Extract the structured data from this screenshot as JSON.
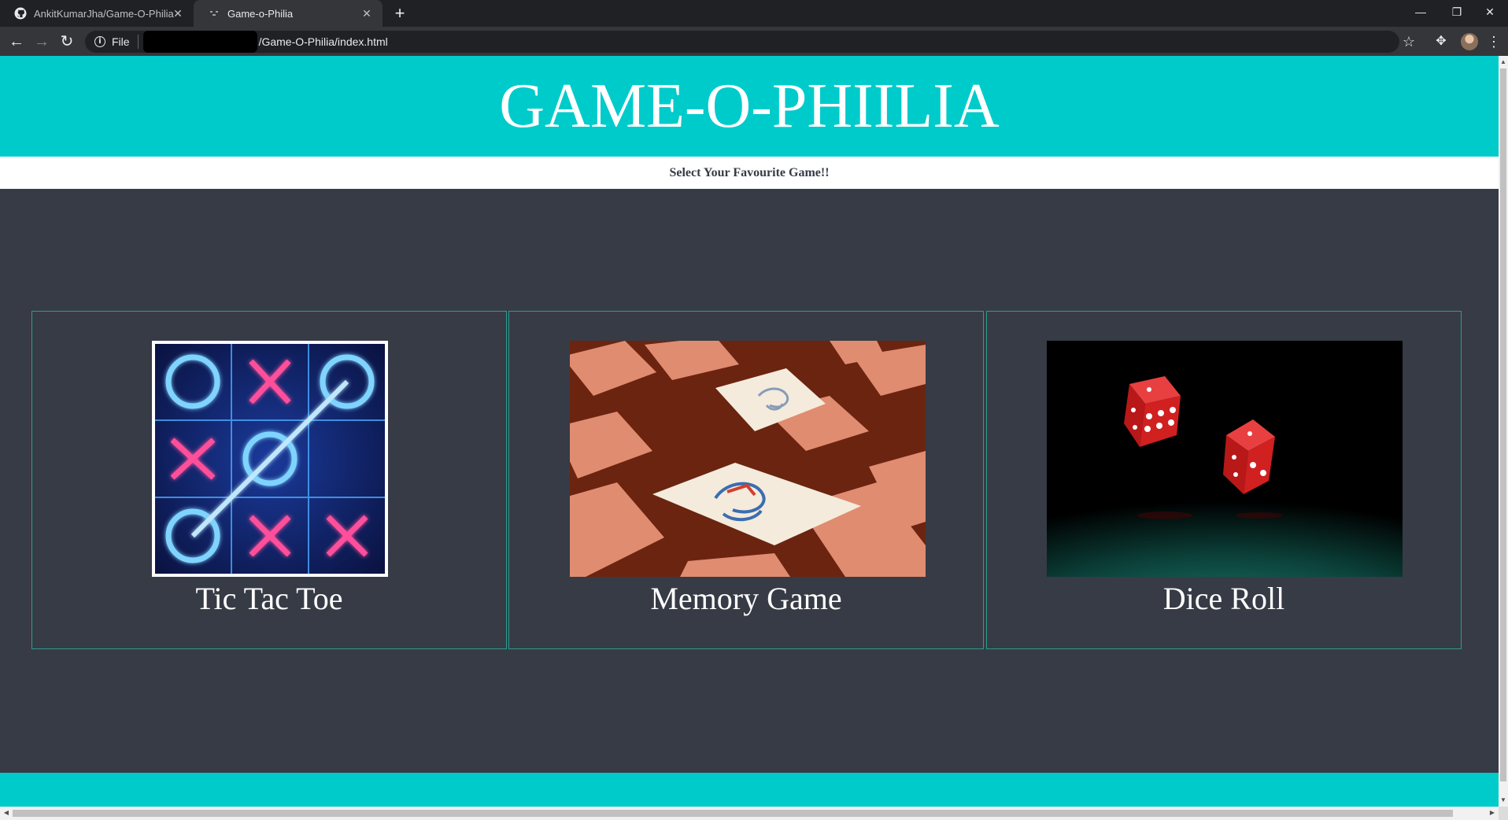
{
  "browser": {
    "tabs": [
      {
        "title": "AnkitKumarJha/Game-O-Philia",
        "icon": "github-icon"
      },
      {
        "title": "Game-o-Philia",
        "icon": "page-icon"
      }
    ],
    "address": {
      "scheme_label": "File",
      "path": "/Game-O-Philia/index.html"
    }
  },
  "page": {
    "title": "GAME-O-PHIILIA",
    "subtitle": "Select Your Favourite Game!!",
    "colors": {
      "accent": "#00cbcb",
      "background": "#373b45",
      "card_border": "#2a9d8f"
    },
    "games": [
      {
        "name": "Tic Tac Toe",
        "image": "tic-tac-toe-neon-board"
      },
      {
        "name": "Memory Game",
        "image": "memory-cards-photo"
      },
      {
        "name": "Dice Roll",
        "image": "red-dice-photo"
      }
    ]
  }
}
